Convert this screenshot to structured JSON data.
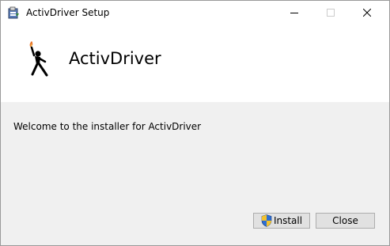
{
  "window": {
    "title": "ActivDriver Setup",
    "app_icon": "installer-package-icon",
    "controls": {
      "minimize": "minimize-icon",
      "maximize": "maximize-icon",
      "close": "close-icon"
    }
  },
  "banner": {
    "logo": "torch-figure-logo",
    "product_name": "ActivDriver"
  },
  "main": {
    "welcome_text": "Welcome to the installer for ActivDriver"
  },
  "buttons": {
    "install_label": "Install",
    "install_icon": "uac-shield-icon",
    "close_label": "Close"
  },
  "colors": {
    "content_background": "#f0f0f0",
    "button_background": "#e1e1e1",
    "button_border": "#adadad",
    "logo_figure": "#000000",
    "logo_flame": "#e8742a"
  }
}
